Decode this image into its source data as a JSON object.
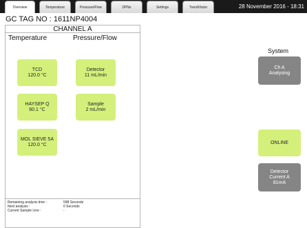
{
  "tabs": [
    {
      "label": "Overview",
      "active": true
    },
    {
      "label": "Temperature",
      "active": false
    },
    {
      "label": "Pressure/Flow",
      "active": false
    },
    {
      "label": "DPNs",
      "active": false
    },
    {
      "label": "Settings",
      "active": false
    },
    {
      "label": "TrendVision",
      "active": false
    }
  ],
  "datetime": "28 November 2016 - 18:31",
  "gc_tag": "GC TAG NO : 1611NP4004",
  "channel": {
    "title": "CHANNEL A",
    "temperature_header": "Temperature",
    "pressure_header": "Pressure/Flow",
    "temperature_tiles": [
      {
        "name": "TCD",
        "value": "120.0 °C"
      },
      {
        "name": "HAYSEP Q",
        "value": "60.1 °C"
      },
      {
        "name": "MOL SIEVE 5A",
        "value": "120.0 °C"
      }
    ],
    "flow_tiles": [
      {
        "name": "Detector",
        "value": "11 mL/min"
      },
      {
        "name": "Sample",
        "value": "2 mL/min"
      }
    ],
    "status": {
      "remaining_label": "Remaining analysis time :",
      "remaining_value": "598 Seconds",
      "next_label": "Next analysis :",
      "next_value": "0 Seconds",
      "sample_label": "Current Sample Line :",
      "sample_value": "-"
    }
  },
  "system": {
    "label": "System",
    "chA": "Ch A\nAnalysing",
    "online": "ONLINE",
    "detector": "Detector\nCurrent A\n81mA"
  },
  "colors": {
    "tile_green": "#d4f07b",
    "tile_grey": "#858585",
    "topbar": "#1a1a1a"
  }
}
